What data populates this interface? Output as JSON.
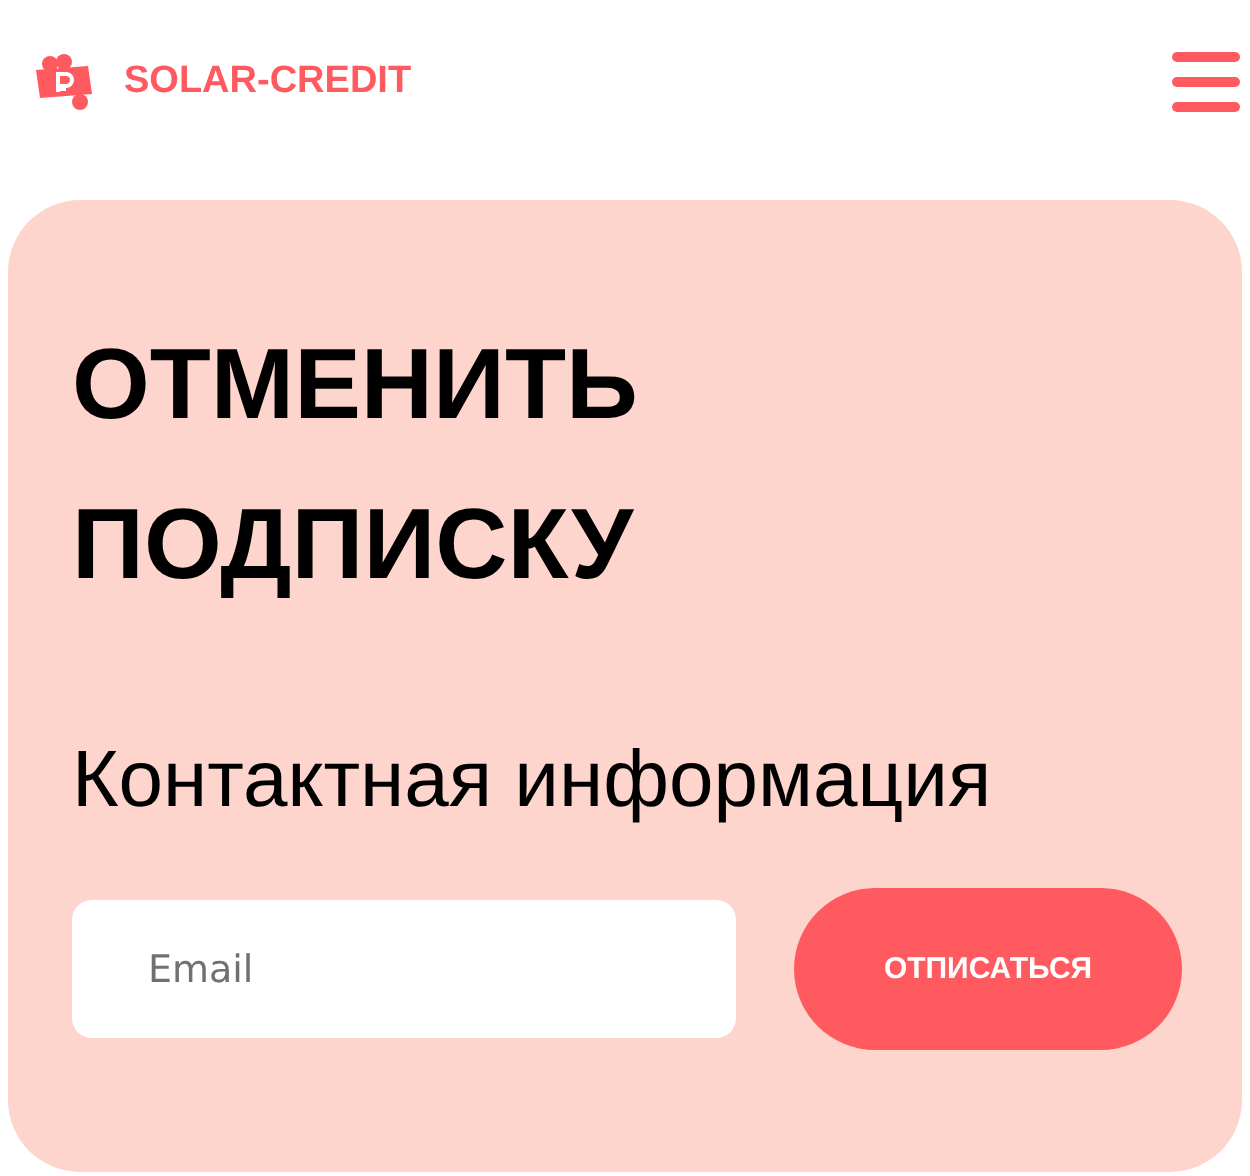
{
  "header": {
    "brand": "SOLAR-CREDIT"
  },
  "card": {
    "title": "ОТМЕНИТЬ ПОДПИСКУ",
    "subtitle": "Контактная информация",
    "email": {
      "placeholder": "Email"
    },
    "button": "ОТПИСАТЬСЯ"
  }
}
